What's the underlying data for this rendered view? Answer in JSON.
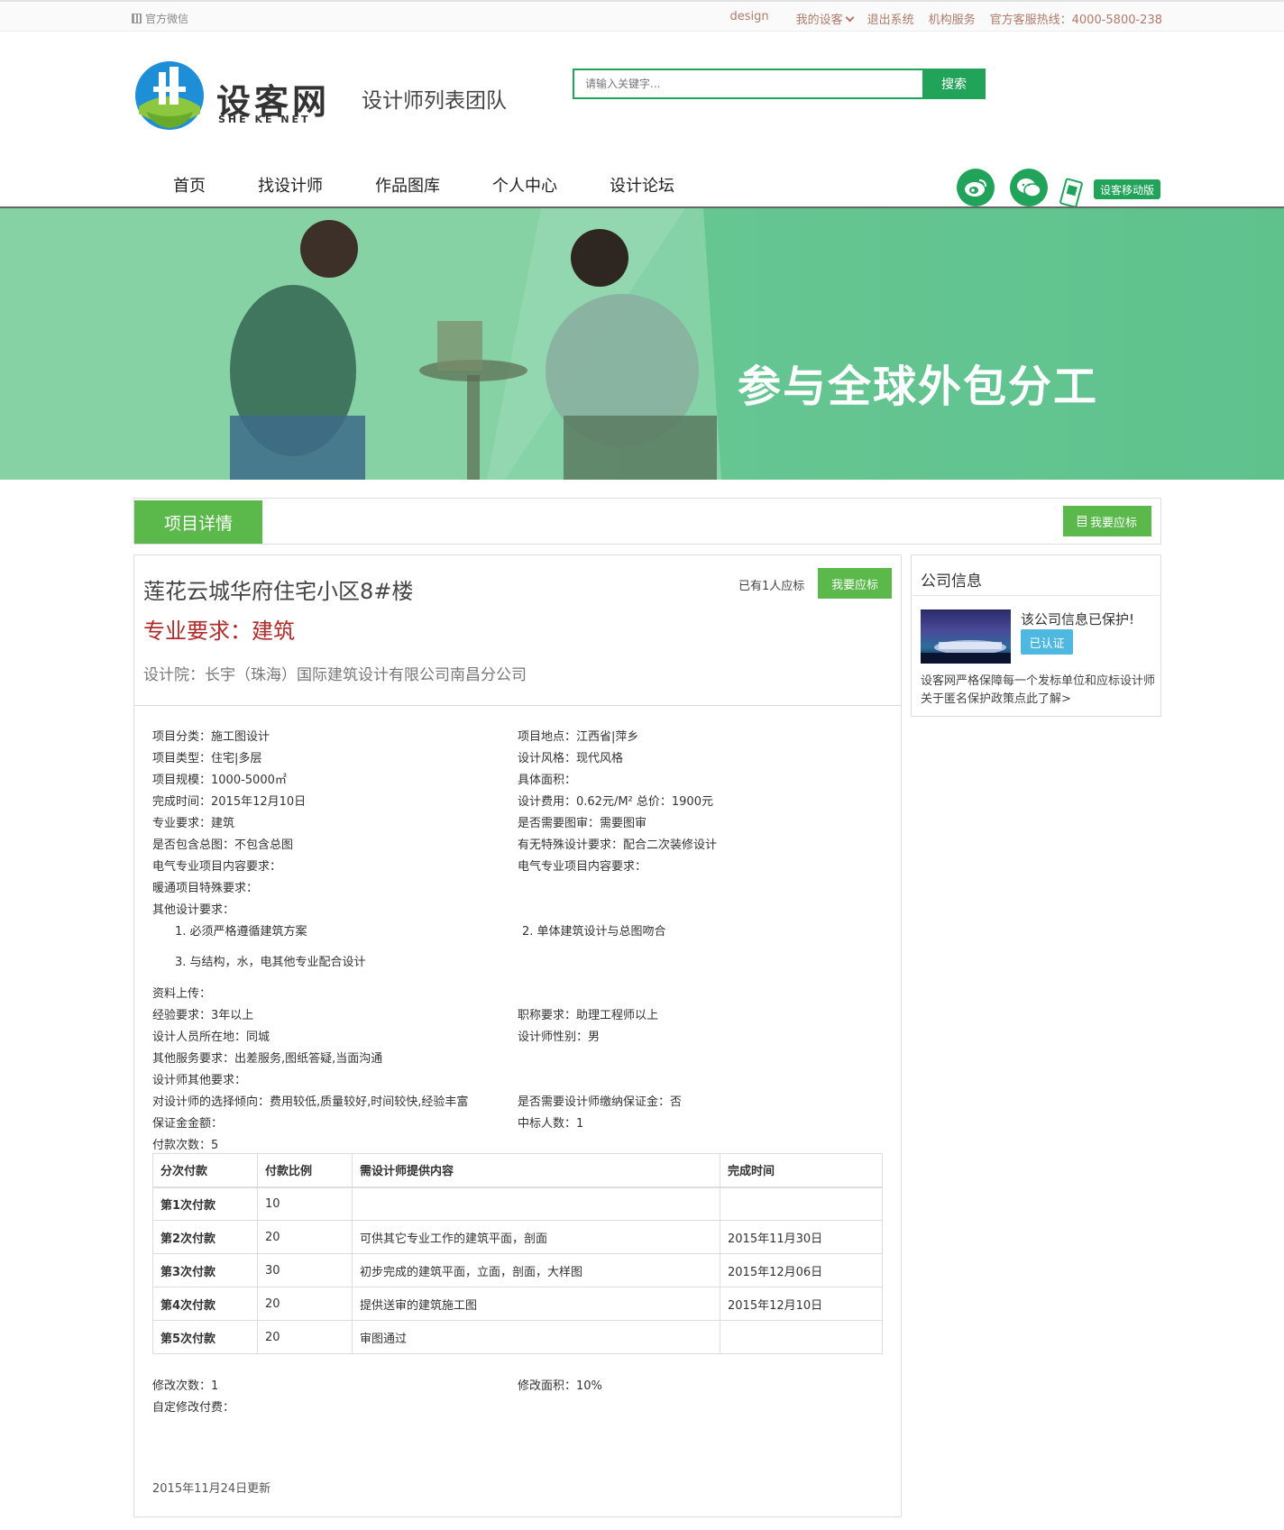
{
  "topbar": {
    "wechat_label": "官方微信",
    "links": [
      "design",
      "我的设客",
      "退出系统",
      "机构服务",
      "官方客服热线：4000-5800-238"
    ]
  },
  "brand": {
    "name": "设客网",
    "sub": "SHE KE NET",
    "page_subtitle": "设计师列表团队",
    "accent_color": "#22a35a"
  },
  "search": {
    "placeholder": "请输入关键字...",
    "button": "搜索"
  },
  "nav": {
    "items": [
      "首页",
      "找设计师",
      "作品图库",
      "个人中心",
      "设计论坛"
    ],
    "mobile": "设客移动版"
  },
  "banner": {
    "text": "参与全球外包分工"
  },
  "tabbar": {
    "active_tab": "项目详情",
    "bid_button": "我要应标"
  },
  "project": {
    "title": "莲花云城华府住宅小区8#楼",
    "major": "专业要求：建筑",
    "institute": "设计院：长宇（珠海）国际建筑设计有限公司南昌分公司",
    "bid_count": "已有1人应标",
    "bid_button": "我要应标",
    "fields_left": [
      "项目分类：施工图设计",
      "项目类型：住宅|多层",
      "项目规模：1000-5000㎡",
      "完成时间：2015年12月10日",
      "专业要求：建筑",
      "是否包含总图：不包含总图",
      "电气专业项目内容要求：",
      "暖通项目特殊要求：",
      "其他设计要求："
    ],
    "fields_right": [
      "项目地点：江西省|萍乡",
      "设计风格：现代风格",
      "具体面积：",
      "设计费用：0.62元/M²   总价：1900元",
      "是否需要图审：需要图审",
      "有无特殊设计要求：配合二次装修设计",
      "电气专业项目内容要求："
    ],
    "other_reqs": [
      "1. 必须严格遵循建筑方案",
      "2. 单体建筑设计与总图吻合",
      "3. 与结构，水，电其他专业配合设计"
    ],
    "upload": "资料上传：",
    "req_left": [
      "经验要求：3年以上",
      "设计人员所在地：同城",
      "其他服务要求：出差服务,图纸答疑,当面沟通",
      "设计师其他要求：",
      "对设计师的选择倾向：费用较低,质量较好,时间较快,经验丰富",
      "保证金金额：",
      "付款次数：5"
    ],
    "req_right": [
      "职称要求：助理工程师以上",
      "设计师性别：男",
      "是否需要设计师缴纳保证金：否",
      "中标人数：1"
    ],
    "payment_headers": [
      "分次付款",
      "付款比例",
      "需设计师提供内容",
      "完成时间"
    ],
    "payments": [
      [
        "第1次付款",
        "10",
        "",
        ""
      ],
      [
        "第2次付款",
        "20",
        "可供其它专业工作的建筑平面，剖面",
        "2015年11月30日"
      ],
      [
        "第3次付款",
        "30",
        "初步完成的建筑平面，立面，剖面，大样图",
        "2015年12月06日"
      ],
      [
        "第4次付款",
        "20",
        "提供送审的建筑施工图",
        "2015年12月10日"
      ],
      [
        "第5次付款",
        "20",
        "审图通过",
        ""
      ]
    ],
    "revise_count": "修改次数：1",
    "revise_area": "修改面积：10%",
    "custom_fee": "自定修改付费：",
    "updated": "2015年11月24日更新"
  },
  "company": {
    "title": "公司信息",
    "protect": "该公司信息已保护!",
    "verified": "已认证",
    "note": "设客网严格保障每一个发标单位和应标设计师 关于匿名保护政策点此了解>"
  }
}
